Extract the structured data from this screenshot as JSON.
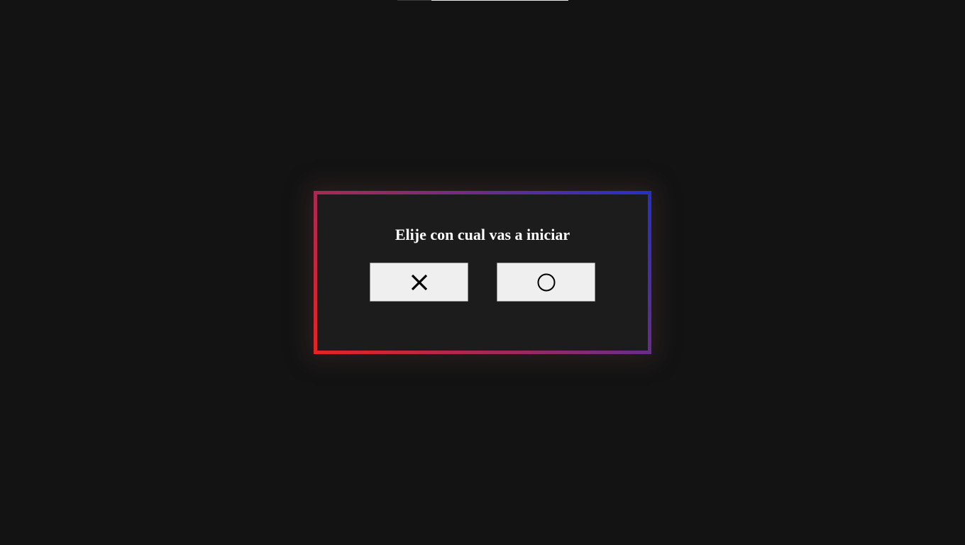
{
  "dialog": {
    "title": "Elije con cual vas a iniciar",
    "options": [
      {
        "symbol": "X",
        "icon": "x-mark-icon"
      },
      {
        "symbol": "O",
        "icon": "circle-icon"
      }
    ]
  },
  "colors": {
    "background": "#131313",
    "panel": "#1c1c1c",
    "border_gradient_start": "#e52424",
    "border_gradient_end": "#2430c8",
    "button_bg": "#efefef",
    "text": "#ffffff"
  }
}
